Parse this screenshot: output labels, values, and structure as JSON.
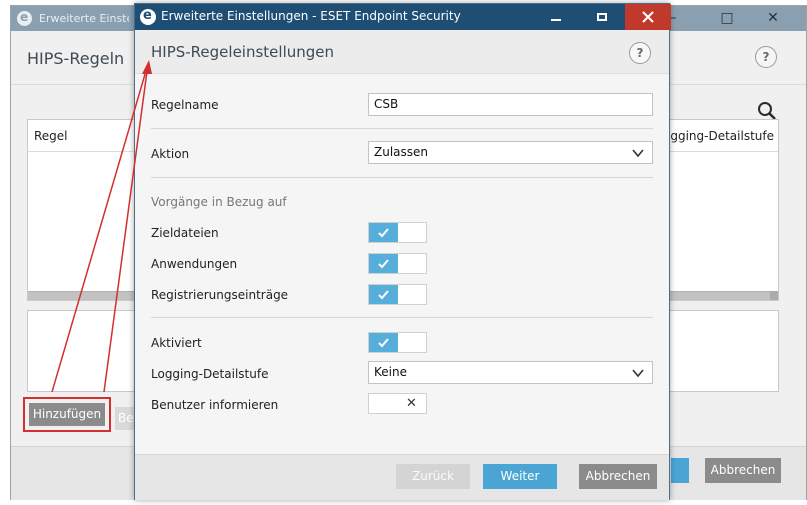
{
  "background_window": {
    "title": "Erweiterte Einstell",
    "header_title": "HIPS-Regeln",
    "help_symbol": "?",
    "table": {
      "columns": [
        "Regel",
        "Logging-Detailstufe"
      ]
    },
    "buttons": {
      "add": "Hinzufügen",
      "partial": "Be",
      "cancel": "Abbrechen"
    },
    "controls": {
      "minimize": "–",
      "maximize": "□",
      "close": "✕"
    }
  },
  "dialog": {
    "title": "Erweiterte Einstellungen - ESET Endpoint Security",
    "header_title": "HIPS-Regeleinstellungen",
    "help_symbol": "?",
    "fields": {
      "regelname_label": "Regelname",
      "regelname_value": "CSB",
      "aktion_label": "Aktion",
      "aktion_value": "Zulassen",
      "section_label": "Vorgänge in Bezug auf",
      "zieldateien_label": "Zieldateien",
      "anwendungen_label": "Anwendungen",
      "registrierung_label": "Registrierungseinträge",
      "aktiviert_label": "Aktiviert",
      "logging_label": "Logging-Detailstufe",
      "logging_value": "Keine",
      "benutzer_label": "Benutzer informieren"
    },
    "toggles": {
      "zieldateien": true,
      "anwendungen": true,
      "registrierung": true,
      "aktiviert": true,
      "benutzer_informieren": false
    },
    "buttons": {
      "back": "Zurück",
      "next": "Weiter",
      "cancel": "Abbrechen"
    }
  },
  "colors": {
    "dialog_titlebar": "#1e4e74",
    "close_button": "#c0392b",
    "toggle_on": "#56aedb",
    "primary_button": "#4aa5d4",
    "annotation": "#d32f2f"
  },
  "icons": [
    "eset-app-icon",
    "help-icon",
    "search-icon",
    "chevron-down-icon",
    "check-icon",
    "x-icon",
    "minimize-icon",
    "maximize-icon",
    "close-icon"
  ]
}
